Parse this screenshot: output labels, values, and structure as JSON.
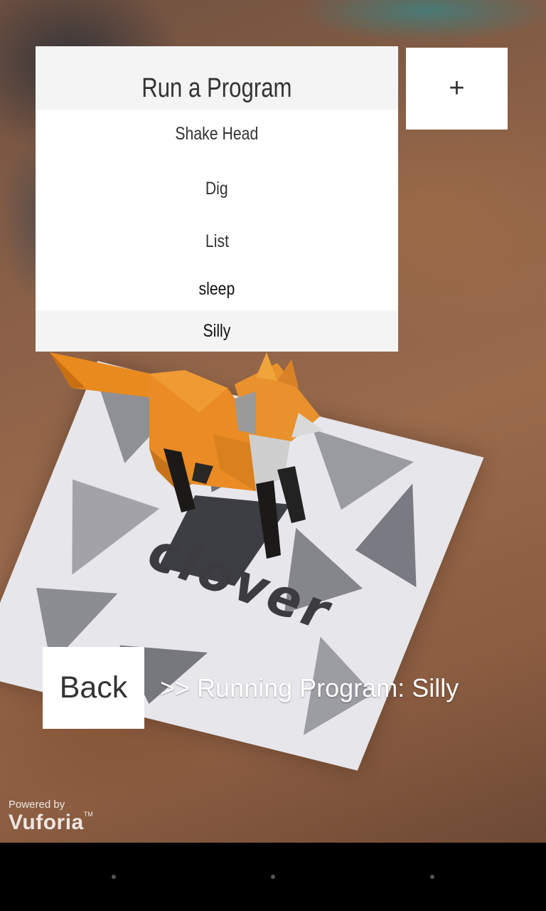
{
  "menu": {
    "title": "Run a Program",
    "items": [
      {
        "label": "Shake Head"
      },
      {
        "label": "Dig"
      },
      {
        "label": "List"
      },
      {
        "label": "sleep"
      },
      {
        "label": "Silly"
      }
    ]
  },
  "add_button": {
    "label": "+"
  },
  "back_button": {
    "label": "Back"
  },
  "status": {
    "text": ">> Running Program: Silly"
  },
  "marker": {
    "text": "clover"
  },
  "watermark": {
    "line1": "Powered by",
    "line2": "Vuforia",
    "tm": "TM"
  },
  "colors": {
    "menu_bg": "#ffffff",
    "menu_header_bg": "#f4f4f4",
    "fox_orange": "#e98a1f"
  },
  "icons": {
    "nav": [
      "back-icon",
      "home-icon",
      "recents-icon"
    ]
  }
}
